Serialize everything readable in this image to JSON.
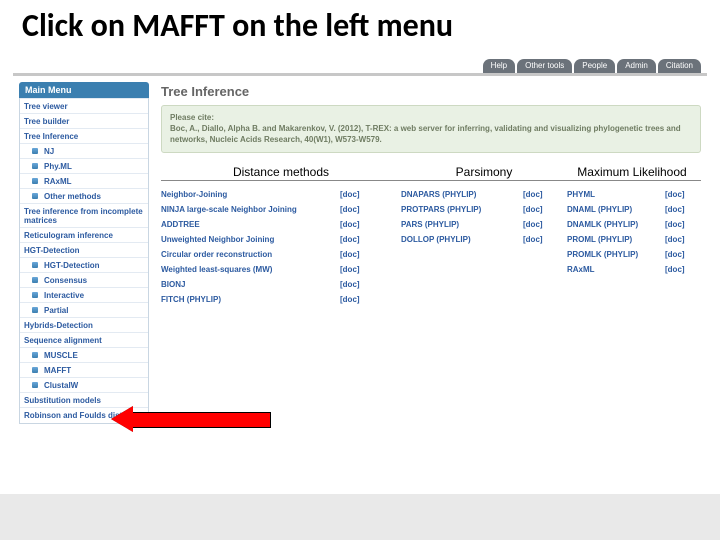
{
  "slide": {
    "title": "Click on MAFFT on the left menu"
  },
  "topnav": {
    "items": [
      {
        "label": "Help"
      },
      {
        "label": "Other tools"
      },
      {
        "label": "People"
      },
      {
        "label": "Admin"
      },
      {
        "label": "Citation"
      }
    ]
  },
  "sidebar": {
    "header": "Main Menu",
    "items": [
      {
        "label": "Tree viewer",
        "sub": false
      },
      {
        "label": "Tree builder",
        "sub": false
      },
      {
        "label": "Tree Inference",
        "sub": false
      },
      {
        "label": "NJ",
        "sub": true
      },
      {
        "label": "Phy.ML",
        "sub": true
      },
      {
        "label": "RAxML",
        "sub": true
      },
      {
        "label": "Other methods",
        "sub": true
      },
      {
        "label": "Tree inference from incomplete matrices",
        "sub": false,
        "multi": true
      },
      {
        "label": "Reticulogram inference",
        "sub": false
      },
      {
        "label": "HGT-Detection",
        "sub": false
      },
      {
        "label": "HGT-Detection",
        "sub": true
      },
      {
        "label": "Consensus",
        "sub": true
      },
      {
        "label": "Interactive",
        "sub": true
      },
      {
        "label": "Partial",
        "sub": true
      },
      {
        "label": "Hybrids-Detection",
        "sub": false
      },
      {
        "label": "Sequence alignment",
        "sub": false
      },
      {
        "label": "MUSCLE",
        "sub": true
      },
      {
        "label": "MAFFT",
        "sub": true
      },
      {
        "label": "ClustalW",
        "sub": true
      },
      {
        "label": "Substitution models",
        "sub": false
      },
      {
        "label": "Robinson and Foulds distance",
        "sub": false,
        "multi": true
      }
    ]
  },
  "main": {
    "title": "Tree Inference",
    "cite_lead": "Please cite:",
    "cite_text": "Boc, A., Diallo, Alpha B. and Makarenkov, V. (2012), T-REX: a web server for inferring, validating and visualizing phylogenetic trees and networks, Nucleic Acids Research, 40(W1), W573-W579.",
    "columns": {
      "c1": {
        "header": "Distance methods",
        "doc": "[doc]",
        "items": [
          "Neighbor-Joining",
          "NINJA large-scale Neighbor Joining",
          "ADDTREE",
          "Unweighted Neighbor Joining",
          "Circular order reconstruction",
          "Weighted least-squares (MW)",
          "BIONJ",
          "FITCH (PHYLIP)"
        ]
      },
      "c2": {
        "header": "Parsimony",
        "doc": "[doc]",
        "items": [
          "DNAPARS (PHYLIP)",
          "PROTPARS (PHYLIP)",
          "PARS (PHYLIP)",
          "DOLLOP (PHYLIP)"
        ]
      },
      "c3": {
        "header": "Maximum Likelihood",
        "doc": "[doc]",
        "items": [
          "PHYML",
          "DNAML (PHYLIP)",
          "DNAMLK (PHYLIP)",
          "PROML (PHYLIP)",
          "PROMLK (PHYLIP)",
          "RAxML"
        ]
      }
    }
  }
}
